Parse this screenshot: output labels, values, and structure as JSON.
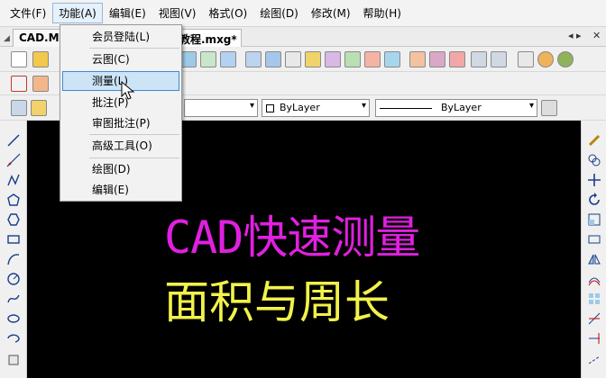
{
  "menubar": [
    {
      "id": "file",
      "label": "文件(F)"
    },
    {
      "id": "function",
      "label": "功能(A)"
    },
    {
      "id": "edit",
      "label": "编辑(E)"
    },
    {
      "id": "view",
      "label": "视图(V)"
    },
    {
      "id": "format",
      "label": "格式(O)"
    },
    {
      "id": "draw",
      "label": "绘图(D)"
    },
    {
      "id": "modify",
      "label": "修改(M)"
    },
    {
      "id": "help",
      "label": "帮助(H)"
    }
  ],
  "tabs": {
    "tab1": "CAD.M",
    "tab2": "教程.mxg*",
    "nav": "◂ ▸",
    "close": "✕"
  },
  "dropdown": {
    "items": [
      {
        "label": "会员登陆(L)"
      },
      {
        "label": "云图(C)"
      },
      {
        "label": "测量(L)"
      },
      {
        "label": "批注(P)"
      },
      {
        "label": "审图批注(P)"
      },
      {
        "label": "高级工具(O)"
      },
      {
        "label": "绘图(D)"
      },
      {
        "label": "编辑(E)"
      }
    ]
  },
  "properties": {
    "color_label": "ByLayer",
    "linetype_label": "ByLayer"
  },
  "canvas": {
    "line1": "CAD快速测量",
    "line2": "面积与周长"
  },
  "colors": {
    "canvas_bg": "#000000",
    "title_magenta": "#e020e0",
    "title_yellow": "#f2f24a",
    "menu_highlight": "#cde4f7"
  },
  "icons": {
    "cursor": "arrow-cursor-icon",
    "tab_close": "close-icon"
  }
}
